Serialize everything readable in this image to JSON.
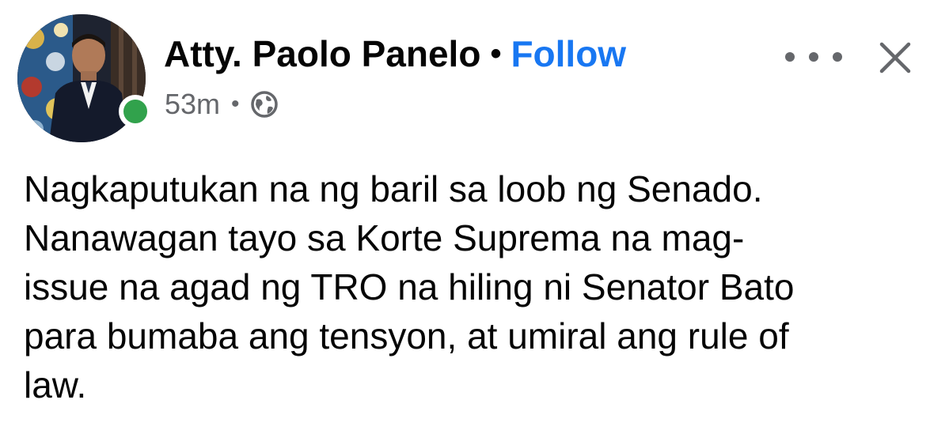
{
  "author": {
    "name": "Atty. Paolo Panelo",
    "separator": "•",
    "follow_label": "Follow",
    "avatar_icon": "profile-photo",
    "status_icon": "online-status-dot"
  },
  "meta": {
    "time": "53m",
    "separator": "•",
    "privacy_icon": "globe-icon"
  },
  "controls": {
    "more_icon": "more-options-icon",
    "close_icon": "close-icon"
  },
  "post": {
    "text": "Nagkaputukan na ng baril sa loob ng Senado.\nNanawagan tayo sa Korte Suprema na mag-\nissue na agad ng TRO na hiling ni Senator Bato\npara bumaba ang tensyon, at umiral ang rule of\nlaw."
  },
  "colors": {
    "follow": "#1877f2",
    "secondary_text": "#65676b",
    "online": "#31a24c",
    "text": "#050505"
  }
}
